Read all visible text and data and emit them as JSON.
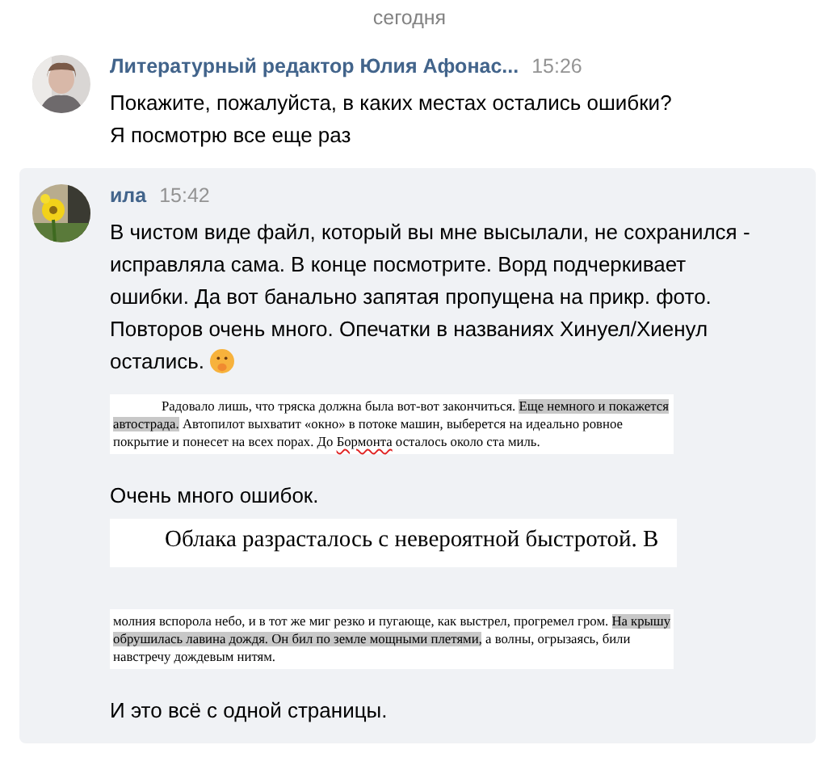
{
  "date_divider": "сегодня",
  "messages": [
    {
      "sender": "Литературный редактор Юлия Афонас...",
      "time": "15:26",
      "avatar": {
        "kind": "picture"
      },
      "highlighted": false,
      "content": [
        {
          "kind": "text",
          "text": "Покажите, пожалуйста, в каких местах остались ошибки?"
        },
        {
          "kind": "text",
          "text": "Я посмотрю все еще раз"
        }
      ]
    },
    {
      "sender": "ила",
      "time": "15:42",
      "avatar": {
        "kind": "picture"
      },
      "highlighted": true,
      "content": [
        {
          "kind": "text",
          "text": "В чистом виде файл, который вы мне высылали, не сохранился - исправляла сама. В конце посмотрите. Ворд подчеркивает ошибки. Да вот банально запятая пропущена на прикр. фото. Повторов очень много. Опечатки в названиях Хинуел/Хиенул остались.",
          "emoji": true
        },
        {
          "kind": "document",
          "large_type": false,
          "indent": true,
          "segments": [
            {
              "kind": "plain",
              "text": "Радовало лишь, что тряска должна была вот-вот закончиться. "
            },
            {
              "kind": "highlighted",
              "text": "Еще немного и покажется автострада."
            },
            {
              "kind": "plain",
              "text": " Автопилот выхватит «окно» в потоке машин, выберется на идеально ровное покрытие и понесет на всех порах. До "
            },
            {
              "kind": "misspelled",
              "text": "Бормонта"
            },
            {
              "kind": "plain",
              "text": " осталось около ста миль."
            }
          ]
        },
        {
          "kind": "text",
          "text": "Очень много ошибок."
        },
        {
          "kind": "document",
          "large_type": true,
          "indent": true,
          "segments": [
            {
              "kind": "plain",
              "text": "Облака разрасталось с невероятной быстротой. В"
            }
          ]
        },
        {
          "kind": "document",
          "large_type": false,
          "indent": false,
          "segments": [
            {
              "kind": "plain",
              "text": "молния вспорола небо, и в тот же миг резко и пугающе, как выстрел, прогремел гром. "
            },
            {
              "kind": "highlighted",
              "text": "На крышу обрушилась лавина дождя. Он бил по земле мощными плетями,"
            },
            {
              "kind": "plain",
              "text": " а волны, огрызаясь, били навстречу дождевым нитям."
            }
          ]
        },
        {
          "kind": "text",
          "text": "И это всё с одной страницы."
        }
      ]
    }
  ]
}
